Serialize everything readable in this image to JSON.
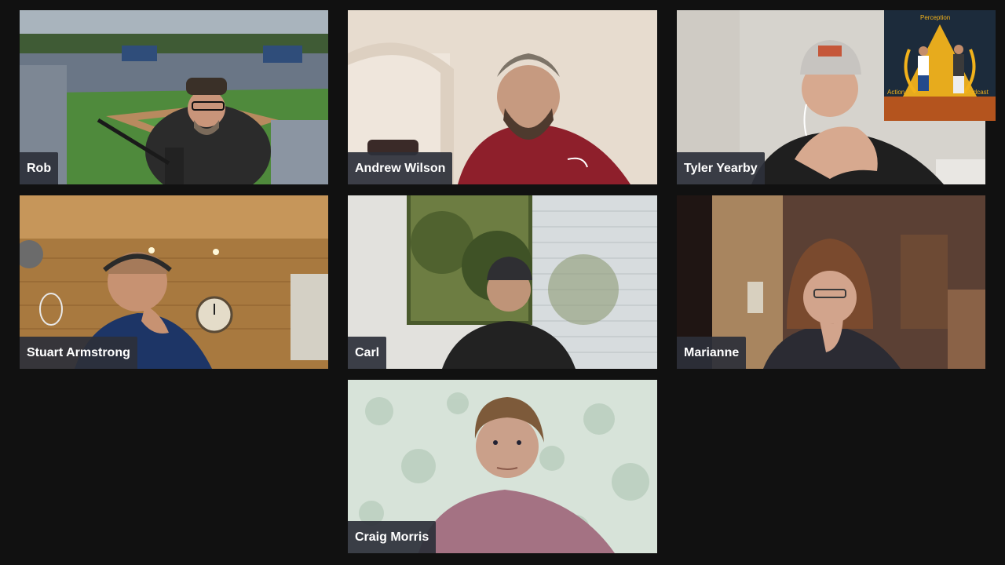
{
  "participants": [
    {
      "name": "Rob"
    },
    {
      "name": "Andrew Wilson"
    },
    {
      "name": "Tyler Yearby"
    },
    {
      "name": "Stuart Armstrong"
    },
    {
      "name": "Carl"
    },
    {
      "name": "Marianne"
    },
    {
      "name": "Craig Morris"
    }
  ],
  "logo": {
    "top_text": "Perception",
    "left_text": "Action",
    "right_text": "Podcast",
    "accent_color": "#f2b21b"
  },
  "colors": {
    "background": "#111111",
    "name_tag_bg": "#2c303a",
    "name_tag_text": "#ffffff"
  }
}
